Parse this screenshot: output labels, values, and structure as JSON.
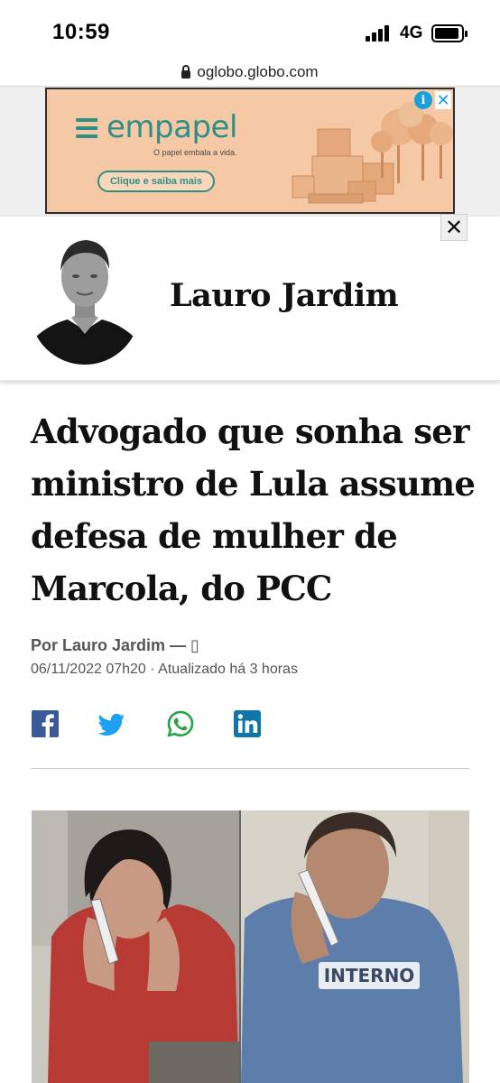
{
  "status_bar": {
    "time": "10:59",
    "network": "4G"
  },
  "browser": {
    "url": "oglobo.globo.com"
  },
  "ad": {
    "brand": "empapel",
    "tagline": "O papel embala a vida.",
    "cta": "Clique e saiba mais",
    "info_symbol": "i",
    "close_symbol": "✕",
    "brand_color": "#2f8f86",
    "background_color": "#f6c9a6"
  },
  "ad_close": {
    "symbol": "✕"
  },
  "column": {
    "name": "Lauro Jardim"
  },
  "article": {
    "headline": "Advogado que sonha ser ministro de Lula assume defesa de mulher de Marcola, do PCC",
    "byline": "Por Lauro Jardim — ▯",
    "dateline": "06/11/2022 07h20 · Atualizado há 3 horas"
  },
  "share": {
    "icons": [
      "facebook-icon",
      "twitter-icon",
      "whatsapp-icon",
      "linkedin-icon"
    ],
    "colors": {
      "facebook": "#3b5998",
      "twitter": "#1da1f2",
      "whatsapp": "#25a244",
      "linkedin": "#0e76a8"
    }
  },
  "photo": {
    "shirt_text": "INTERNO"
  }
}
